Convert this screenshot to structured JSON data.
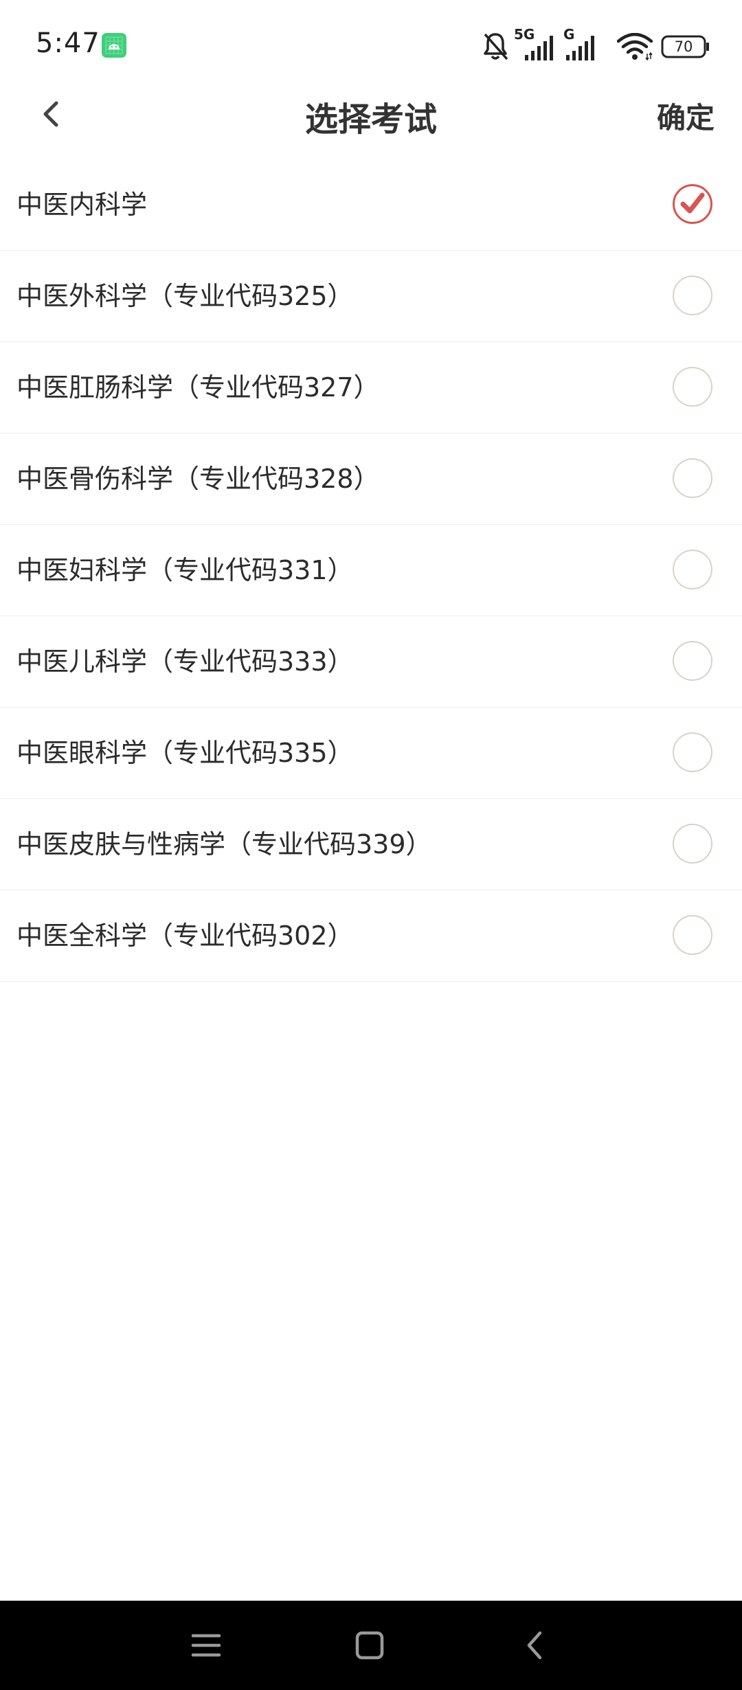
{
  "status_bar": {
    "time": "5:47",
    "network_5g": "5G",
    "network_g": "G",
    "battery": "70"
  },
  "header": {
    "title": "选择考试",
    "confirm_label": "确定"
  },
  "exam_options": [
    {
      "label": "中医内科学",
      "selected": true
    },
    {
      "label": "中医外科学（专业代码325）",
      "selected": false
    },
    {
      "label": "中医肛肠科学（专业代码327）",
      "selected": false
    },
    {
      "label": "中医骨伤科学（专业代码328）",
      "selected": false
    },
    {
      "label": "中医妇科学（专业代码331）",
      "selected": false
    },
    {
      "label": "中医儿科学（专业代码333）",
      "selected": false
    },
    {
      "label": "中医眼科学（专业代码335）",
      "selected": false
    },
    {
      "label": "中医皮肤与性病学（专业代码339）",
      "selected": false
    },
    {
      "label": "中医全科学（专业代码302）",
      "selected": false
    }
  ],
  "colors": {
    "check_accent": "#d9534f",
    "radio_border": "#d9d2c9",
    "app_icon": "#3ecf7a"
  }
}
